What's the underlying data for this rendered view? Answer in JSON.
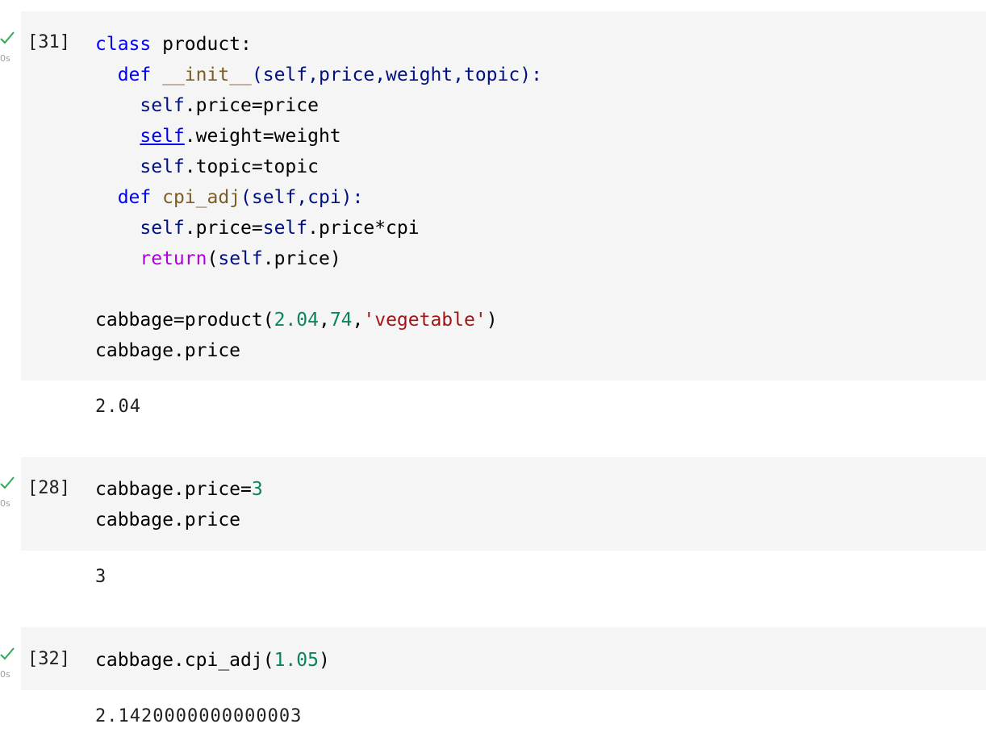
{
  "colors": {
    "cell_bg": "#f5f5f5",
    "keyword": "#0000ff",
    "control_keyword": "#af00db",
    "self": "#001080",
    "function": "#795e26",
    "number": "#098658",
    "string": "#a31515",
    "check": "#34a853"
  },
  "cells": [
    {
      "exec_count": "[31]",
      "status_icon": "check-icon",
      "time": "0s",
      "code": {
        "l1_kw": "class",
        "l1_rest": " product:",
        "l2_kw": "def",
        "l2_fn": "__init__",
        "l2_rest": "(self,price,weight,topic):",
        "l3_self": "self",
        "l3_rest": ".price=price",
        "l4_self": "self",
        "l4_rest": ".weight=weight",
        "l5_self": "self",
        "l5_rest": ".topic=topic",
        "l6_kw": "def",
        "l6_fn": "cpi_adj",
        "l6_rest": "(self,cpi):",
        "l7_self": "self",
        "l7_mid": ".price=",
        "l7_self2": "self",
        "l7_rest": ".price*cpi",
        "l8_kw": "return",
        "l8_p1": "(",
        "l8_self": "self",
        "l8_rest": ".price)",
        "l10_a": "cabbage=product(",
        "l10_n1": "2.04",
        "l10_c1": ",",
        "l10_n2": "74",
        "l10_c2": ",",
        "l10_str": "'vegetable'",
        "l10_end": ")",
        "l11": "cabbage.price"
      },
      "output": "2.04"
    },
    {
      "exec_count": "[28]",
      "status_icon": "check-icon",
      "time": "0s",
      "code": {
        "l1_a": "cabbage.price=",
        "l1_num": "3",
        "l2": "cabbage.price"
      },
      "output": "3"
    },
    {
      "exec_count": "[32]",
      "status_icon": "check-icon",
      "time": "0s",
      "code": {
        "l1_a": "cabbage.cpi_adj(",
        "l1_num": "1.05",
        "l1_end": ")"
      },
      "output": "2.1420000000000003"
    }
  ]
}
